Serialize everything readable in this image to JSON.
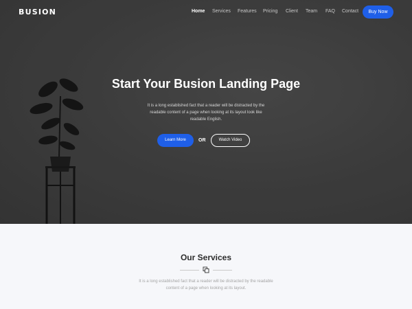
{
  "brand": "BUSION",
  "nav": {
    "items": [
      {
        "label": "Home",
        "active": true
      },
      {
        "label": "Services"
      },
      {
        "label": "Features"
      },
      {
        "label": "Pricing"
      },
      {
        "label": "Client"
      },
      {
        "label": "Team"
      },
      {
        "label": "FAQ"
      },
      {
        "label": "Contact"
      }
    ],
    "buy_label": "Buy Now"
  },
  "hero": {
    "title": "Start Your Busion Landing Page",
    "description_lines": [
      "It is a long established fact that a reader will be distracted by the",
      "readable content of a page when looking at its layout look like",
      "readable English."
    ],
    "learn_label": "Learn More",
    "or_label": "OR",
    "watch_label": "Watch Video"
  },
  "services": {
    "title": "Our Services",
    "icon": "layers-icon",
    "description_lines": [
      "It is a long established fact that a reader will be distracted by the readable",
      "content of a page when looking at its layout."
    ]
  },
  "colors": {
    "accent": "#1f5fe8",
    "hero_bg": "#454545",
    "section_bg": "#f6f7fa"
  }
}
